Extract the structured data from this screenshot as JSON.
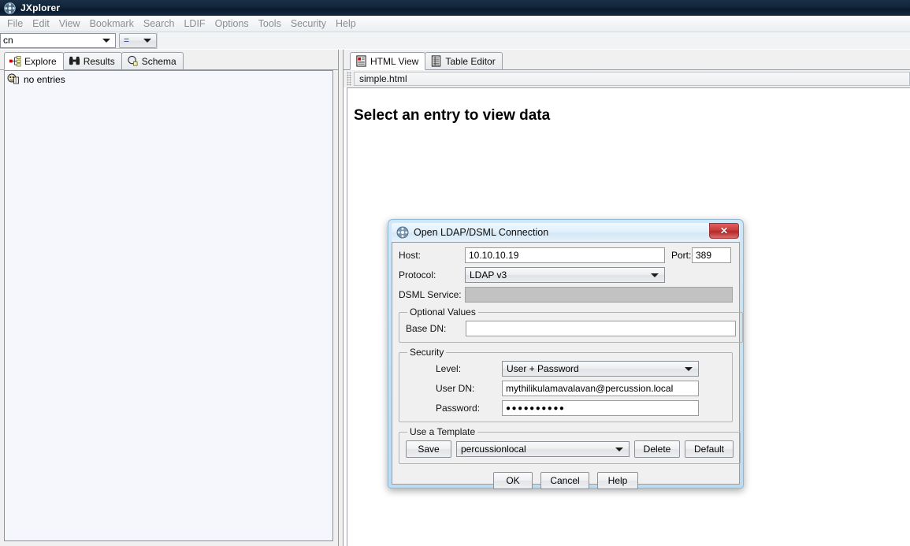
{
  "window": {
    "title": "JXplorer",
    "icon": "jxplorer-logo-icon"
  },
  "menubar": {
    "items": [
      {
        "label": "File"
      },
      {
        "label": "Edit"
      },
      {
        "label": "View"
      },
      {
        "label": "Bookmark"
      },
      {
        "label": "Search"
      },
      {
        "label": "LDIF"
      },
      {
        "label": "Options"
      },
      {
        "label": "Tools"
      },
      {
        "label": "Security"
      },
      {
        "label": "Help"
      }
    ]
  },
  "searchbar": {
    "attribute_value": "cn",
    "operator_value": "="
  },
  "left_pane": {
    "tabs": [
      {
        "label": "Explore",
        "icon": "tree-explore-icon",
        "active": true
      },
      {
        "label": "Results",
        "icon": "binoculars-icon",
        "active": false
      },
      {
        "label": "Schema",
        "icon": "schema-magnifier-icon",
        "active": false
      }
    ],
    "tree": {
      "root_label": "no entries",
      "root_icon": "ldap-entry-icon"
    }
  },
  "right_pane": {
    "tabs": [
      {
        "label": "HTML View",
        "icon": "html-document-icon",
        "active": true
      },
      {
        "label": "Table Editor",
        "icon": "table-document-icon",
        "active": false
      }
    ],
    "document_name": "simple.html",
    "content_heading": "Select an entry to view data"
  },
  "dialog": {
    "title": "Open LDAP/DSML Connection",
    "icon": "jxplorer-logo-icon",
    "close_label": "✕",
    "fields": {
      "host_label": "Host:",
      "host_value": "10.10.10.19",
      "port_label": "Port:",
      "port_value": "389",
      "protocol_label": "Protocol:",
      "protocol_value": "LDAP v3",
      "dsml_label": "DSML Service:",
      "dsml_value": ""
    },
    "optional_values": {
      "legend": "Optional Values",
      "base_dn_label": "Base DN:",
      "base_dn_value": ""
    },
    "security": {
      "legend": "Security",
      "level_label": "Level:",
      "level_value": "User  + Password",
      "user_dn_label": "User DN:",
      "user_dn_value": "mythilikulamavalavan@percussion.local",
      "password_label": "Password:",
      "password_value": "●●●●●●●●●●"
    },
    "template": {
      "legend": "Use a Template",
      "save_label": "Save",
      "template_value": "percussionlocal",
      "delete_label": "Delete",
      "default_label": "Default"
    },
    "buttons": {
      "ok": "OK",
      "cancel": "Cancel",
      "help": "Help"
    }
  },
  "colors": {
    "titlebar": "#12263b",
    "dialog_border": "#bcdcf2",
    "close_button": "#c93b3b",
    "tree_background": "#f6f7fc",
    "menu_text": "#8a8d92"
  }
}
